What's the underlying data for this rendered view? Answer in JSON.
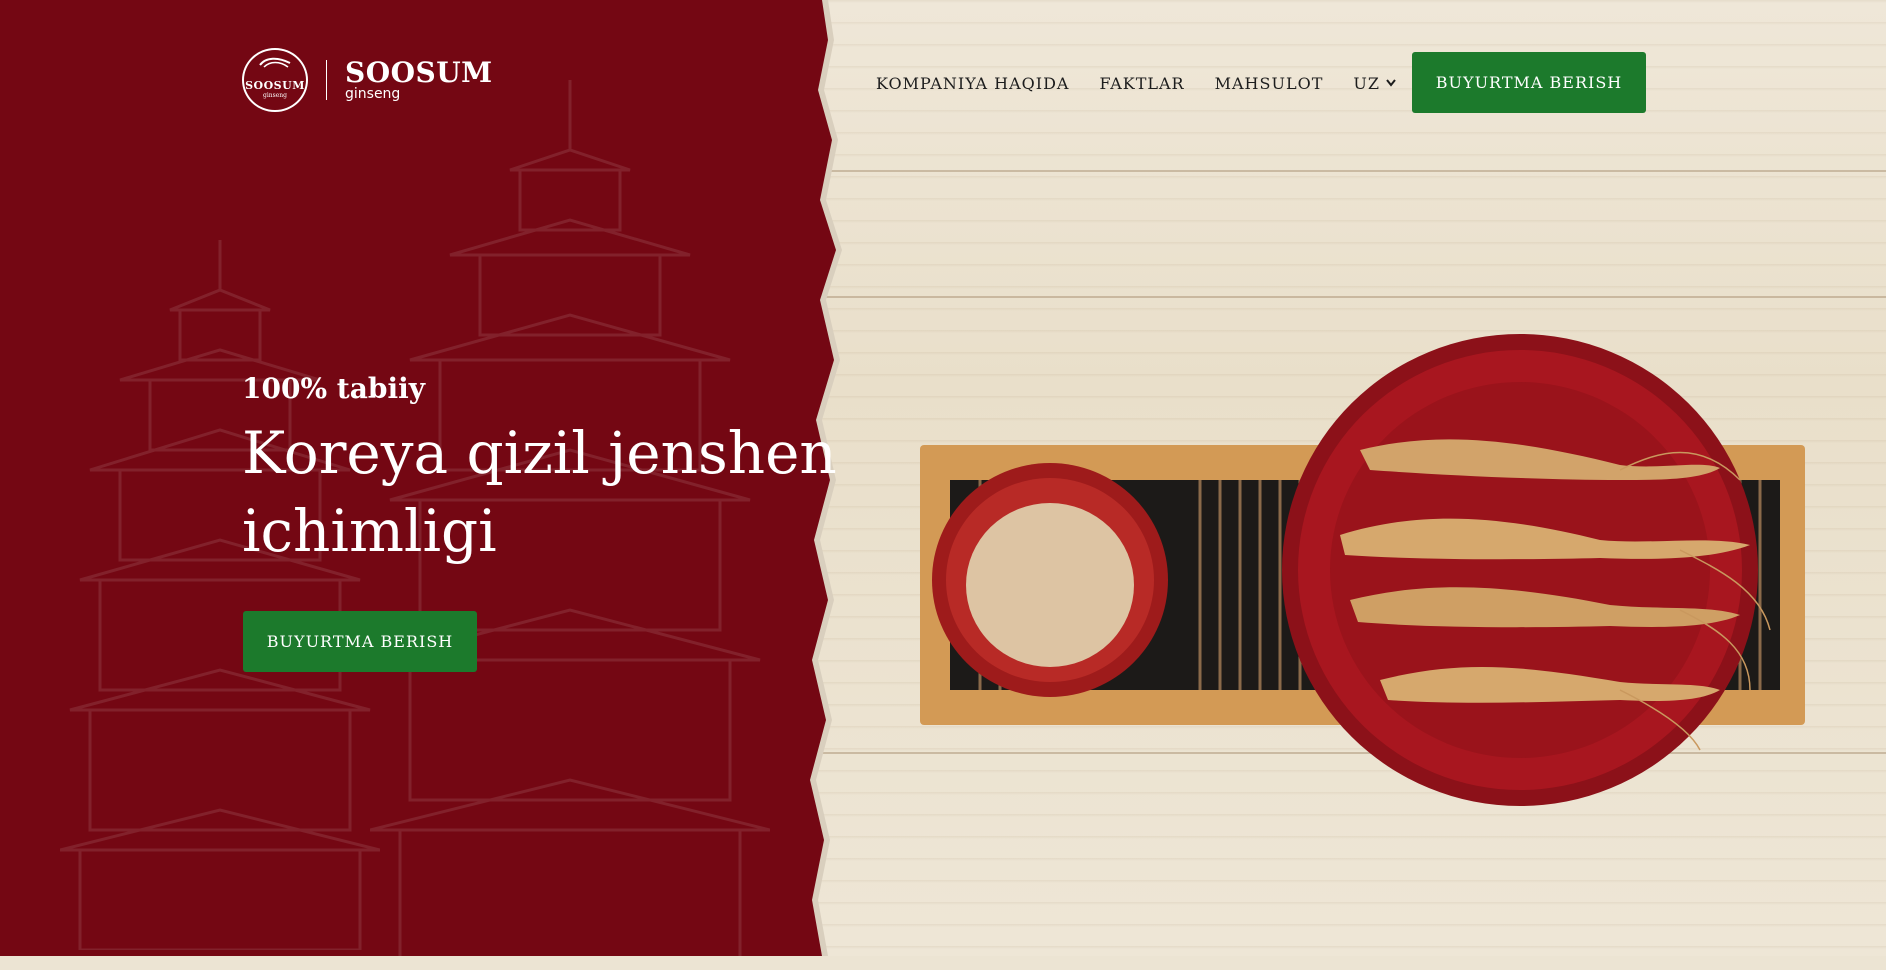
{
  "brand": {
    "name": "SOOSUM",
    "tagline": "ginseng",
    "mark_name": "SOOSUM",
    "mark_sub": "ginseng"
  },
  "nav": {
    "items": [
      {
        "label": "KOMPANIYA HAQIDA"
      },
      {
        "label": "FAKTLAR"
      },
      {
        "label": "MAHSULOT"
      },
      {
        "label": "UZ"
      }
    ],
    "cta_label": "BUYURTMA BERISH"
  },
  "hero": {
    "eyebrow": "100% tabiiy",
    "title": "Koreya qizil jenshen ichimligi",
    "cta_label": "BUYURTMA BERISH"
  },
  "colors": {
    "panel_red": "#740713",
    "button_green": "#1c7a2c",
    "wood": "#ece4d3"
  },
  "icons": {
    "logo": "ginseng-root-logo-icon",
    "language_dropdown": "chevron-down-icon"
  }
}
